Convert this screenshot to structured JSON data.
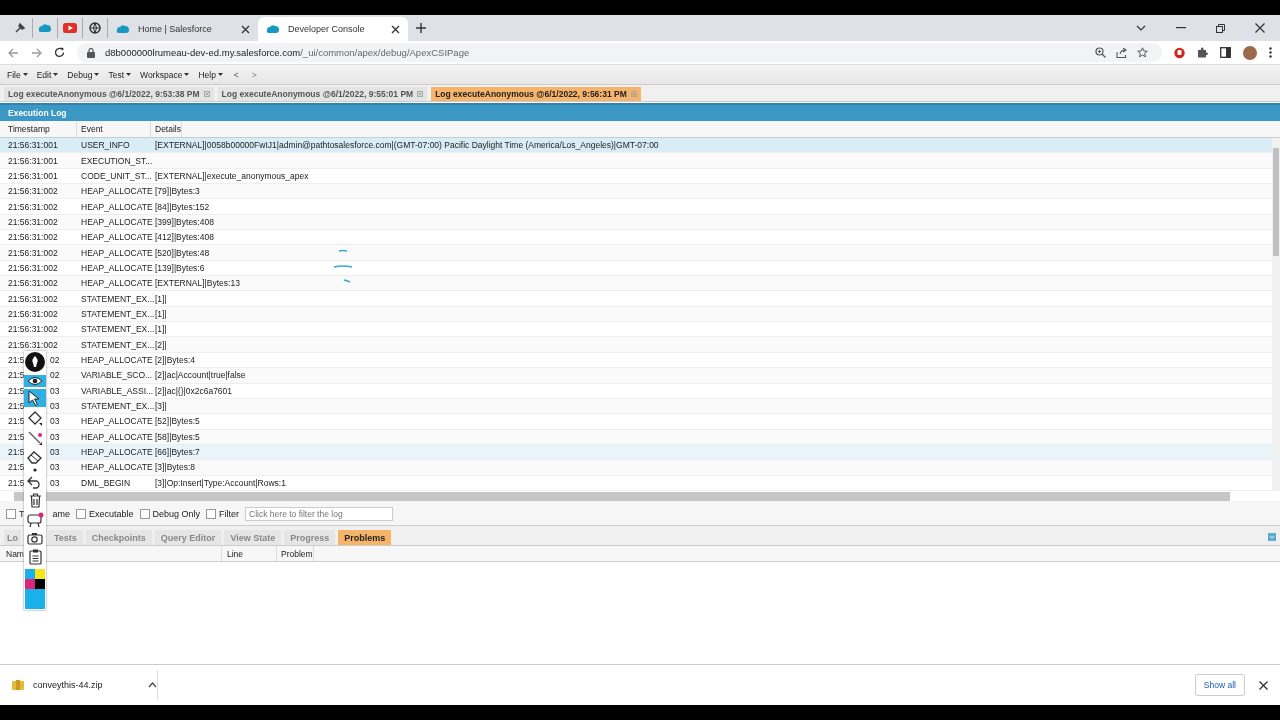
{
  "browser": {
    "pinned_tabs": [
      {
        "kind": "tool"
      },
      {
        "kind": "cloud"
      },
      {
        "kind": "video"
      },
      {
        "kind": "globe"
      }
    ],
    "tabs": [
      {
        "title": "Home | Salesforce",
        "selected": false
      },
      {
        "title": "Developer Console",
        "selected": true
      }
    ],
    "url_host": "d8b000000lrumeau-dev-ed.my.salesforce.com",
    "url_path": "/_ui/common/apex/debug/ApexCSIPage"
  },
  "menu": [
    "File",
    "Edit",
    "Debug",
    "Test",
    "Workspace",
    "Help"
  ],
  "nav": [
    "<",
    ">"
  ],
  "log_tabs": [
    {
      "label": "Log executeAnonymous @6/1/2022, 9:53:38 PM",
      "selected": false
    },
    {
      "label": "Log executeAnonymous @6/1/2022, 9:55:01 PM",
      "selected": false
    },
    {
      "label": "Log executeAnonymous @6/1/2022, 9:56:31 PM",
      "selected": true
    }
  ],
  "panel_title": "Execution Log",
  "columns": [
    "Timestamp",
    "Event",
    "Details"
  ],
  "rows": [
    {
      "timestamp": "21:56:31:001",
      "event": "USER_INFO",
      "details": "[EXTERNAL]|0058b00000FwIJ1|admin@pathtosalesforce.com|(GMT-07:00) Pacific Daylight Time (America/Los_Angeles)|GMT-07:00",
      "selected": true,
      "hovered": false
    },
    {
      "timestamp": "21:56:31:001",
      "event": "EXECUTION_ST...",
      "selected": false,
      "hovered": false
    },
    {
      "timestamp": "21:56:31:001",
      "event": "CODE_UNIT_ST...",
      "details": "[EXTERNAL]|execute_anonymous_apex",
      "selected": false,
      "hovered": false
    },
    {
      "timestamp": "21:56:31:002",
      "event": "HEAP_ALLOCATE",
      "details": "[79]|Bytes:3",
      "selected": false,
      "hovered": false
    },
    {
      "timestamp": "21:56:31:002",
      "event": "HEAP_ALLOCATE",
      "details": "[84]|Bytes:152",
      "selected": false,
      "hovered": false
    },
    {
      "timestamp": "21:56:31:002",
      "event": "HEAP_ALLOCATE",
      "details": "[399]|Bytes:408",
      "selected": false,
      "hovered": false
    },
    {
      "timestamp": "21:56:31:002",
      "event": "HEAP_ALLOCATE",
      "details": "[412]|Bytes:408",
      "selected": false,
      "hovered": false
    },
    {
      "timestamp": "21:56:31:002",
      "event": "HEAP_ALLOCATE",
      "details": "[520]|Bytes:48",
      "selected": false,
      "hovered": false
    },
    {
      "timestamp": "21:56:31:002",
      "event": "HEAP_ALLOCATE",
      "details": "[139]|Bytes:6",
      "selected": false,
      "hovered": false
    },
    {
      "timestamp": "21:56:31:002",
      "event": "HEAP_ALLOCATE",
      "details": "[EXTERNAL]|Bytes:13",
      "selected": false,
      "hovered": false
    },
    {
      "timestamp": "21:56:31:002",
      "event": "STATEMENT_EX...",
      "details": "[1]|",
      "selected": false,
      "hovered": false
    },
    {
      "timestamp": "21:56:31:002",
      "event": "STATEMENT_EX...",
      "details": "[1]|",
      "selected": false,
      "hovered": false
    },
    {
      "timestamp": "21:56:31:002",
      "event": "STATEMENT_EX...",
      "details": "[1]|",
      "selected": false,
      "hovered": false
    },
    {
      "timestamp": "21:56:31:002",
      "event": "STATEMENT_EX...",
      "details": "[2]|",
      "selected": false,
      "hovered": false
    },
    {
      "timestamp_parts": [
        "21:5",
        "02"
      ],
      "event": "HEAP_ALLOCATE",
      "details": "[2]|Bytes:4",
      "selected": false,
      "hovered": false
    },
    {
      "timestamp_parts": [
        "21:5",
        "02"
      ],
      "event": "VARIABLE_SCO...",
      "details": "[2]|ac|Account|true|false",
      "selected": false,
      "hovered": false
    },
    {
      "timestamp_parts": [
        "21:5",
        "03"
      ],
      "event": "VARIABLE_ASSI...",
      "details": "[2]|ac|{}|0x2c6a7601",
      "selected": false,
      "hovered": false
    },
    {
      "timestamp_parts": [
        "21:5",
        "03"
      ],
      "event": "STATEMENT_EX...",
      "details": "[3]|",
      "selected": false,
      "hovered": false
    },
    {
      "timestamp_parts": [
        "21:5",
        "03"
      ],
      "event": "HEAP_ALLOCATE",
      "details": "[52]|Bytes:5",
      "selected": false,
      "hovered": false
    },
    {
      "timestamp_parts": [
        "21:5",
        "03"
      ],
      "event": "HEAP_ALLOCATE",
      "details": "[58]|Bytes:5",
      "selected": false,
      "hovered": false
    },
    {
      "timestamp_parts": [
        "21:5",
        "03"
      ],
      "event": "HEAP_ALLOCATE",
      "details": "[66]|Bytes:7",
      "selected": false,
      "hovered": true
    },
    {
      "timestamp_parts": [
        "21:5",
        "03"
      ],
      "event": "HEAP_ALLOCATE",
      "details": "[3]|Bytes:8",
      "selected": false,
      "hovered": false
    },
    {
      "timestamp_parts": [
        "21:5",
        "03"
      ],
      "event": "DML_BEGIN",
      "details": "[3]|Op:Insert|Type:Account|Rows:1",
      "selected": false,
      "hovered": false
    }
  ],
  "filters": [
    {
      "label_parts": [
        "T",
        "ame"
      ],
      "checked": false
    },
    {
      "label": "Executable",
      "checked": false
    },
    {
      "label": "Debug Only",
      "checked": false
    },
    {
      "label": "Filter",
      "checked": false
    }
  ],
  "filter_field": {
    "placeholder": "Click here to filter the log"
  },
  "bottom_tabs": [
    {
      "label": "Lo",
      "selected": false
    },
    {
      "label": "Tests",
      "selected": false
    },
    {
      "label": "Checkpoints",
      "selected": false
    },
    {
      "label": "Query Editor",
      "selected": false
    },
    {
      "label": "View State",
      "selected": false
    },
    {
      "label": "Progress",
      "selected": false
    },
    {
      "label": "Problems",
      "selected": true
    }
  ],
  "problem_columns": [
    "Nam",
    "Line",
    "Problem"
  ],
  "overlay_tools": [
    {
      "kind": "pen",
      "selected": false
    },
    {
      "kind": "eye",
      "selected": true
    },
    {
      "kind": "pointer",
      "selected": true
    },
    {
      "kind": "highlighter",
      "selected": false
    },
    {
      "kind": "line",
      "selected": false
    },
    {
      "kind": "eraser",
      "selected": false
    },
    {
      "kind": "dot",
      "selected": false
    },
    {
      "kind": "undo",
      "selected": false
    },
    {
      "kind": "trash",
      "selected": false
    },
    {
      "kind": "board",
      "selected": false
    },
    {
      "kind": "camera",
      "selected": false
    },
    {
      "kind": "clipboard",
      "selected": false
    },
    {
      "kind": "palette",
      "selected": false
    }
  ],
  "download": {
    "file": "conveythis-44.zip",
    "button": "Show all"
  }
}
